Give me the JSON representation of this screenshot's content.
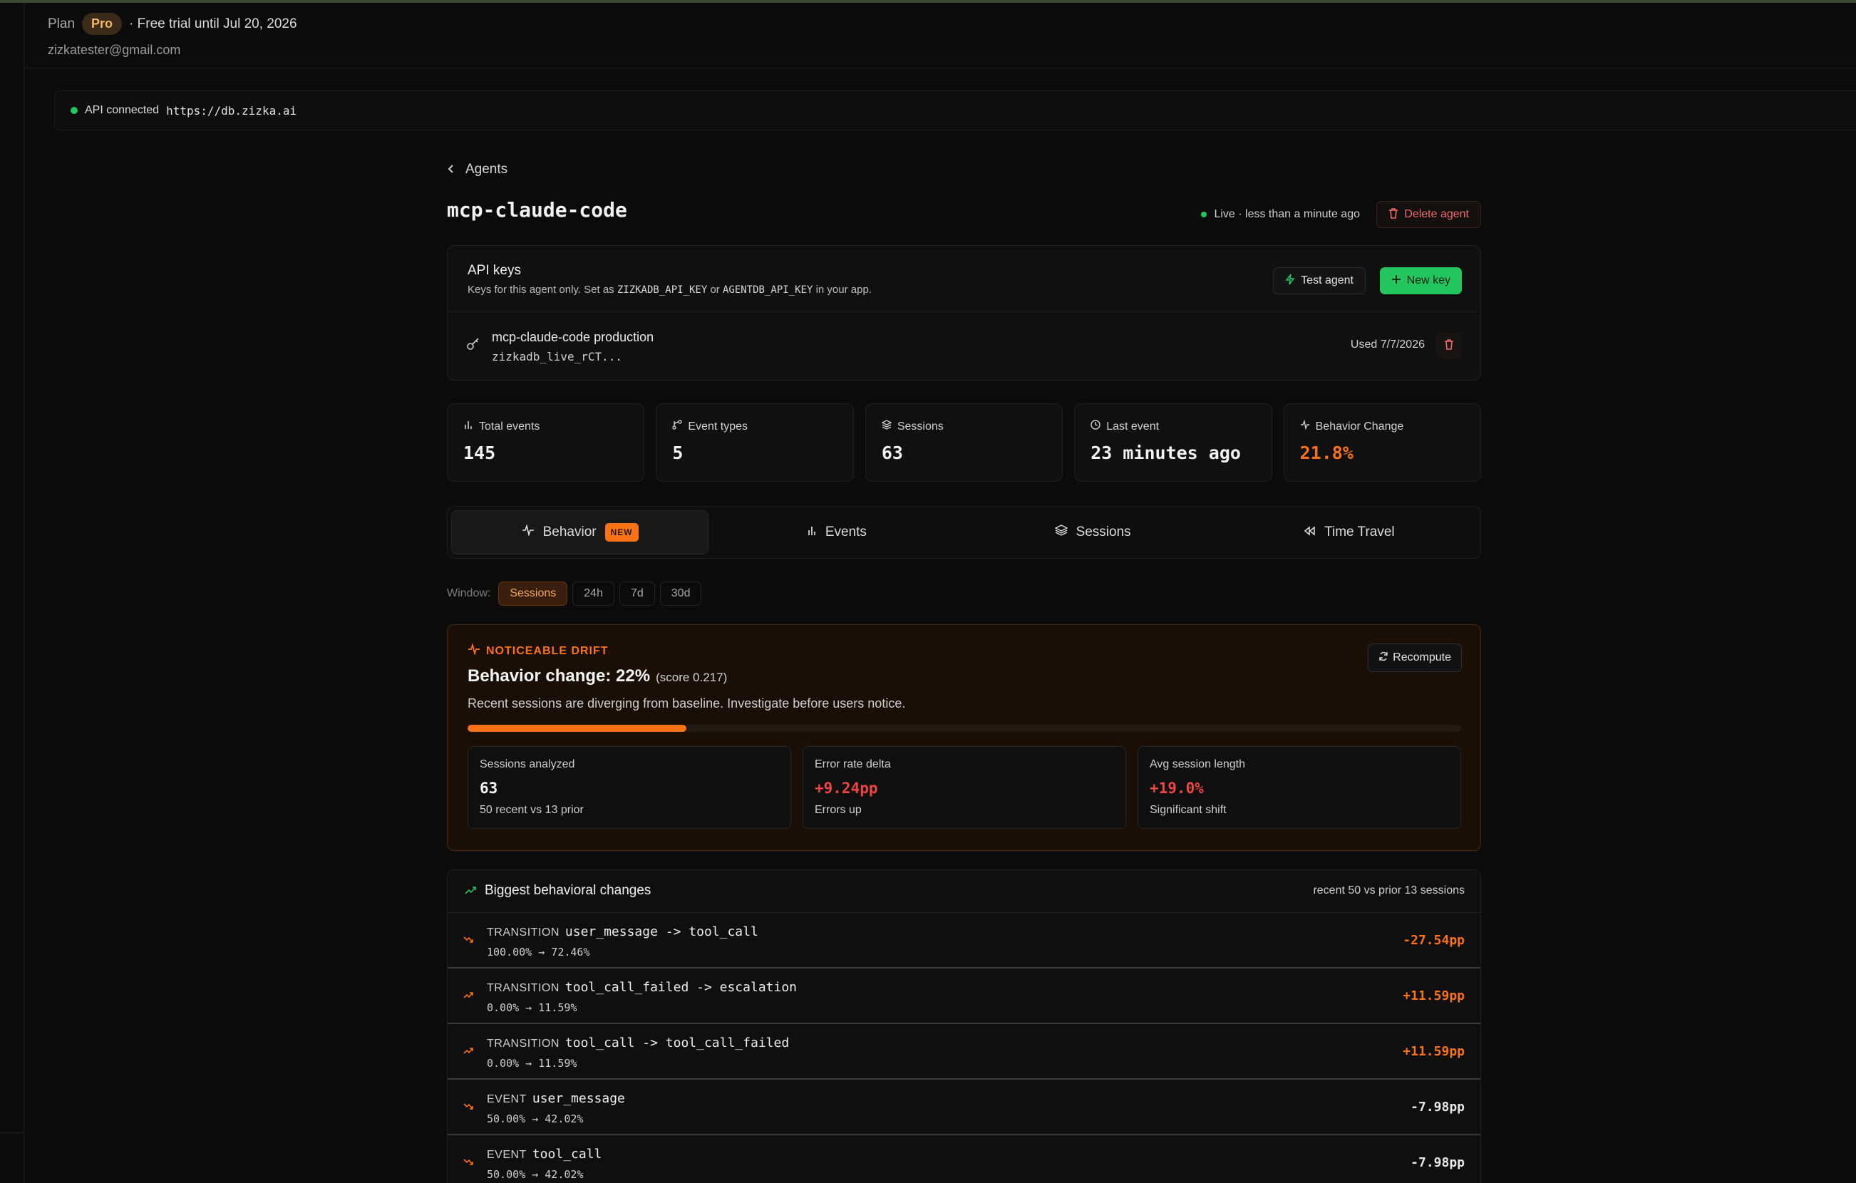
{
  "account": {
    "plan_label": "Plan",
    "plan_badge": "Pro",
    "trial_text": "· Free trial until Jul 20, 2026",
    "email": "zizkatester@gmail.com"
  },
  "api_status": {
    "label": "API connected",
    "url": "https://db.zizka.ai",
    "color": "#22c55e"
  },
  "breadcrumb": {
    "back_label": "Agents"
  },
  "agent": {
    "name": "mcp-claude-code",
    "live_status": "Live · less than a minute ago",
    "delete_label": "Delete agent"
  },
  "api_keys": {
    "title": "API keys",
    "subtitle_pre": "Keys for this agent only. Set as ",
    "env_var_1": "ZIZKADB_API_KEY",
    "subtitle_mid": " or ",
    "env_var_2": "AGENTDB_API_KEY",
    "subtitle_post": " in your app.",
    "test_label": "Test agent",
    "new_key_label": "New key",
    "keys": [
      {
        "name": "mcp-claude-code production",
        "value": "zizkadb_live_rCT...",
        "used": "Used 7/7/2026"
      }
    ]
  },
  "stats": [
    {
      "label": "Total events",
      "value": "145",
      "icon": "bar-chart-icon"
    },
    {
      "label": "Event types",
      "value": "5",
      "icon": "branch-icon"
    },
    {
      "label": "Sessions",
      "value": "63",
      "icon": "layers-icon"
    },
    {
      "label": "Last event",
      "value": "23 minutes ago",
      "icon": "clock-icon"
    },
    {
      "label": "Behavior Change",
      "value": "21.8%",
      "icon": "activity-icon"
    }
  ],
  "tabs": [
    {
      "label": "Behavior",
      "badge": "NEW",
      "active": true
    },
    {
      "label": "Events"
    },
    {
      "label": "Sessions"
    },
    {
      "label": "Time Travel"
    }
  ],
  "window": {
    "label": "Window:",
    "options": [
      "Sessions",
      "24h",
      "7d",
      "30d"
    ],
    "selected": "Sessions"
  },
  "drift": {
    "tag": "NOTICEABLE DRIFT",
    "title": "Behavior change: 22%",
    "score": "(score 0.217)",
    "description": "Recent sessions are diverging from baseline. Investigate before users notice.",
    "recompute_label": "Recompute",
    "progress": 0.22,
    "accent": "#f97316",
    "metrics": [
      {
        "label": "Sessions analyzed",
        "value": "63",
        "sub": "50 recent vs 13 prior",
        "tone": "neutral"
      },
      {
        "label": "Error rate delta",
        "value": "+9.24pp",
        "sub": "Errors up",
        "tone": "red"
      },
      {
        "label": "Avg session length",
        "value": "+19.0%",
        "sub": "Significant shift",
        "tone": "red"
      }
    ]
  },
  "changes": {
    "title": "Biggest behavioral changes",
    "meta": "recent 50 vs prior 13 sessions",
    "rows": [
      {
        "kind": "TRANSITION",
        "name": "user_message -> tool_call",
        "range": "100.00% → 72.46%",
        "delta": "-27.54pp",
        "dir": "down",
        "tone": "orange"
      },
      {
        "kind": "TRANSITION",
        "name": "tool_call_failed -> escalation",
        "range": "0.00% → 11.59%",
        "delta": "+11.59pp",
        "dir": "up",
        "tone": "orange"
      },
      {
        "kind": "TRANSITION",
        "name": "tool_call -> tool_call_failed",
        "range": "0.00% → 11.59%",
        "delta": "+11.59pp",
        "dir": "up",
        "tone": "orange"
      },
      {
        "kind": "EVENT",
        "name": "user_message",
        "range": "50.00% → 42.02%",
        "delta": "-7.98pp",
        "dir": "down",
        "tone": "neutral"
      },
      {
        "kind": "EVENT",
        "name": "tool_call",
        "range": "50.00% → 42.02%",
        "delta": "-7.98pp",
        "dir": "down",
        "tone": "neutral"
      }
    ]
  }
}
